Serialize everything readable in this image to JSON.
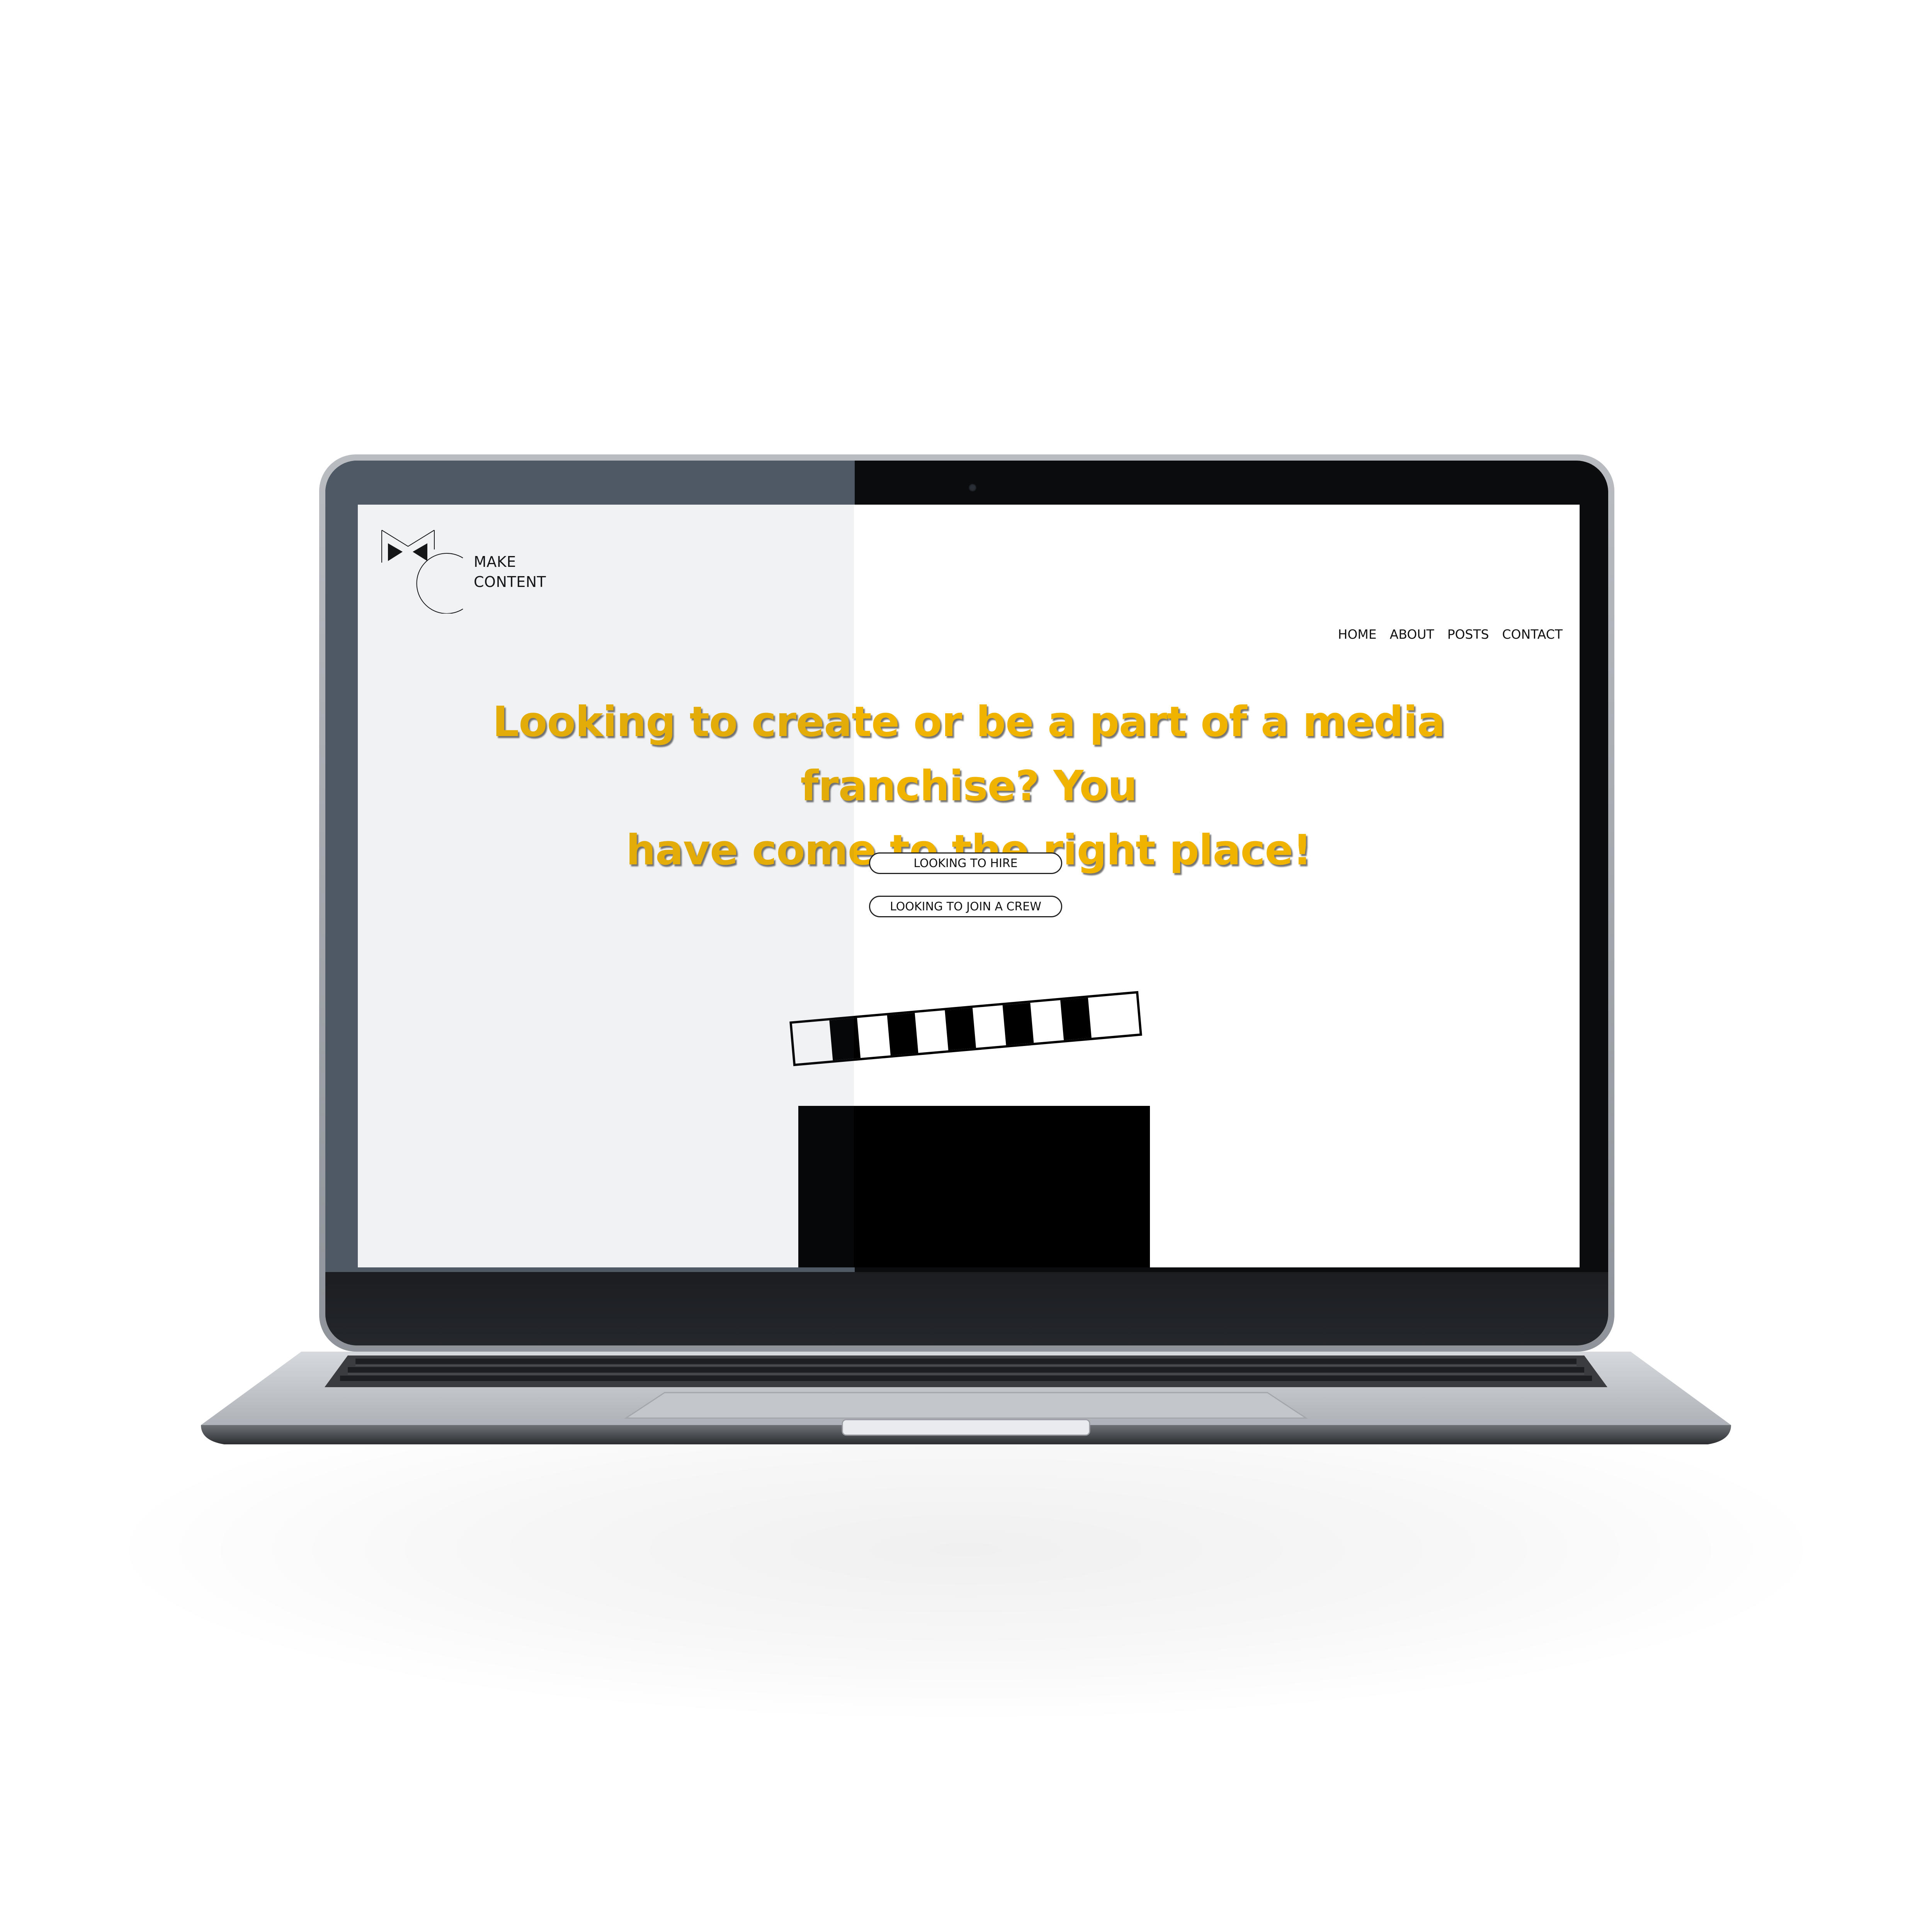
{
  "site": {
    "logo_icon": "mc-logo-icon",
    "logo_line1": "MAKE",
    "logo_line2": "CONTENT"
  },
  "nav": {
    "items": [
      {
        "label": "HOME"
      },
      {
        "label": "ABOUT"
      },
      {
        "label": "POSTS"
      },
      {
        "label": "CONTACT"
      }
    ]
  },
  "hero": {
    "line1": "Looking to create or be a part of a media franchise? You",
    "line2": "have come to the right place!",
    "color": "#f0b400"
  },
  "buttons": {
    "hire_label": "LOOKING TO HIRE",
    "join_label": "LOOKING TO JOIN A CREW"
  },
  "illustration": {
    "icon": "clapperboard-icon"
  }
}
